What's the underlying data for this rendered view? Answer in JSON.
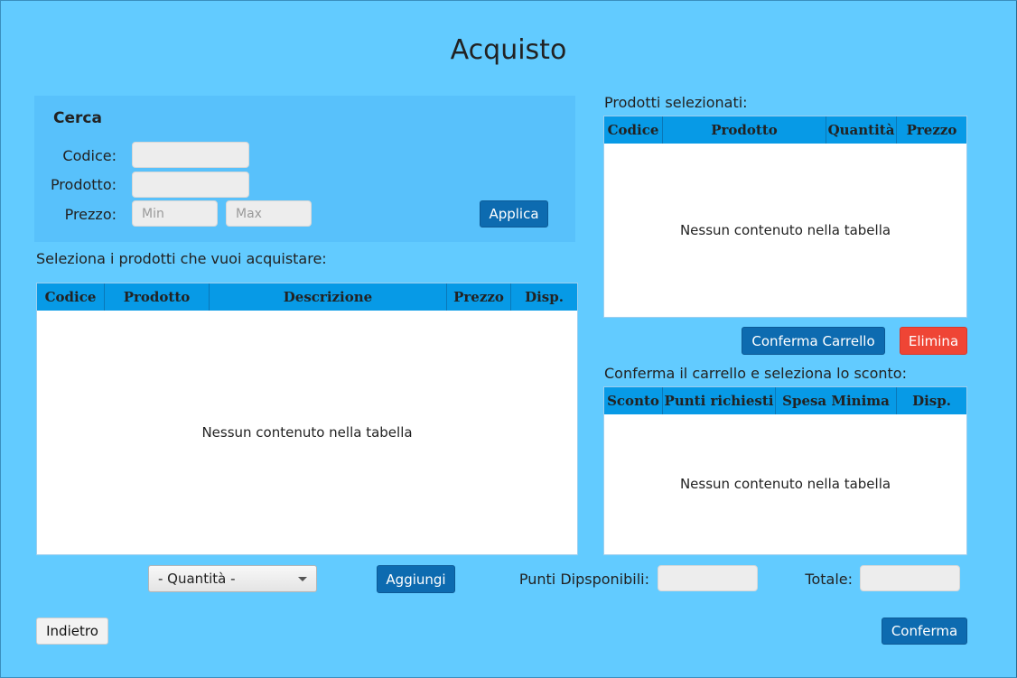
{
  "page": {
    "title": "Acquisto"
  },
  "search": {
    "title": "Cerca",
    "code_label": "Codice:",
    "product_label": "Prodotto:",
    "price_label": "Prezzo:",
    "min_placeholder": "Min",
    "max_placeholder": "Max",
    "apply_label": "Applica"
  },
  "products": {
    "label": "Seleziona i prodotti che vuoi acquistare:",
    "columns": [
      "Codice",
      "Prodotto",
      "Descrizione",
      "Prezzo",
      "Disp."
    ],
    "empty_text": "Nessun contenuto nella tabella"
  },
  "selected": {
    "label": "Prodotti selezionati:",
    "columns": [
      "Codice",
      "Prodotto",
      "Quantità",
      "Prezzo"
    ],
    "empty_text": "Nessun contenuto nella tabella",
    "confirm_cart_label": "Conferma Carrello",
    "delete_label": "Elimina"
  },
  "discount": {
    "label": "Conferma il carrello e seleziona lo sconto:",
    "columns": [
      "Sconto",
      "Punti richiesti",
      "Spesa Minima",
      "Disp."
    ],
    "empty_text": "Nessun contenuto nella tabella"
  },
  "bottom": {
    "quantity_selected": "- Quantità -",
    "add_label": "Aggiungi",
    "points_label": "Punti Dipsponibili:",
    "total_label": "Totale:",
    "back_label": "Indietro",
    "confirm_label": "Conferma"
  },
  "colors": {
    "background": "#62cbff",
    "panel": "#58c1fb",
    "table_header": "#079ae6",
    "primary_button": "#0d6bb0",
    "danger_button": "#ef4535"
  }
}
